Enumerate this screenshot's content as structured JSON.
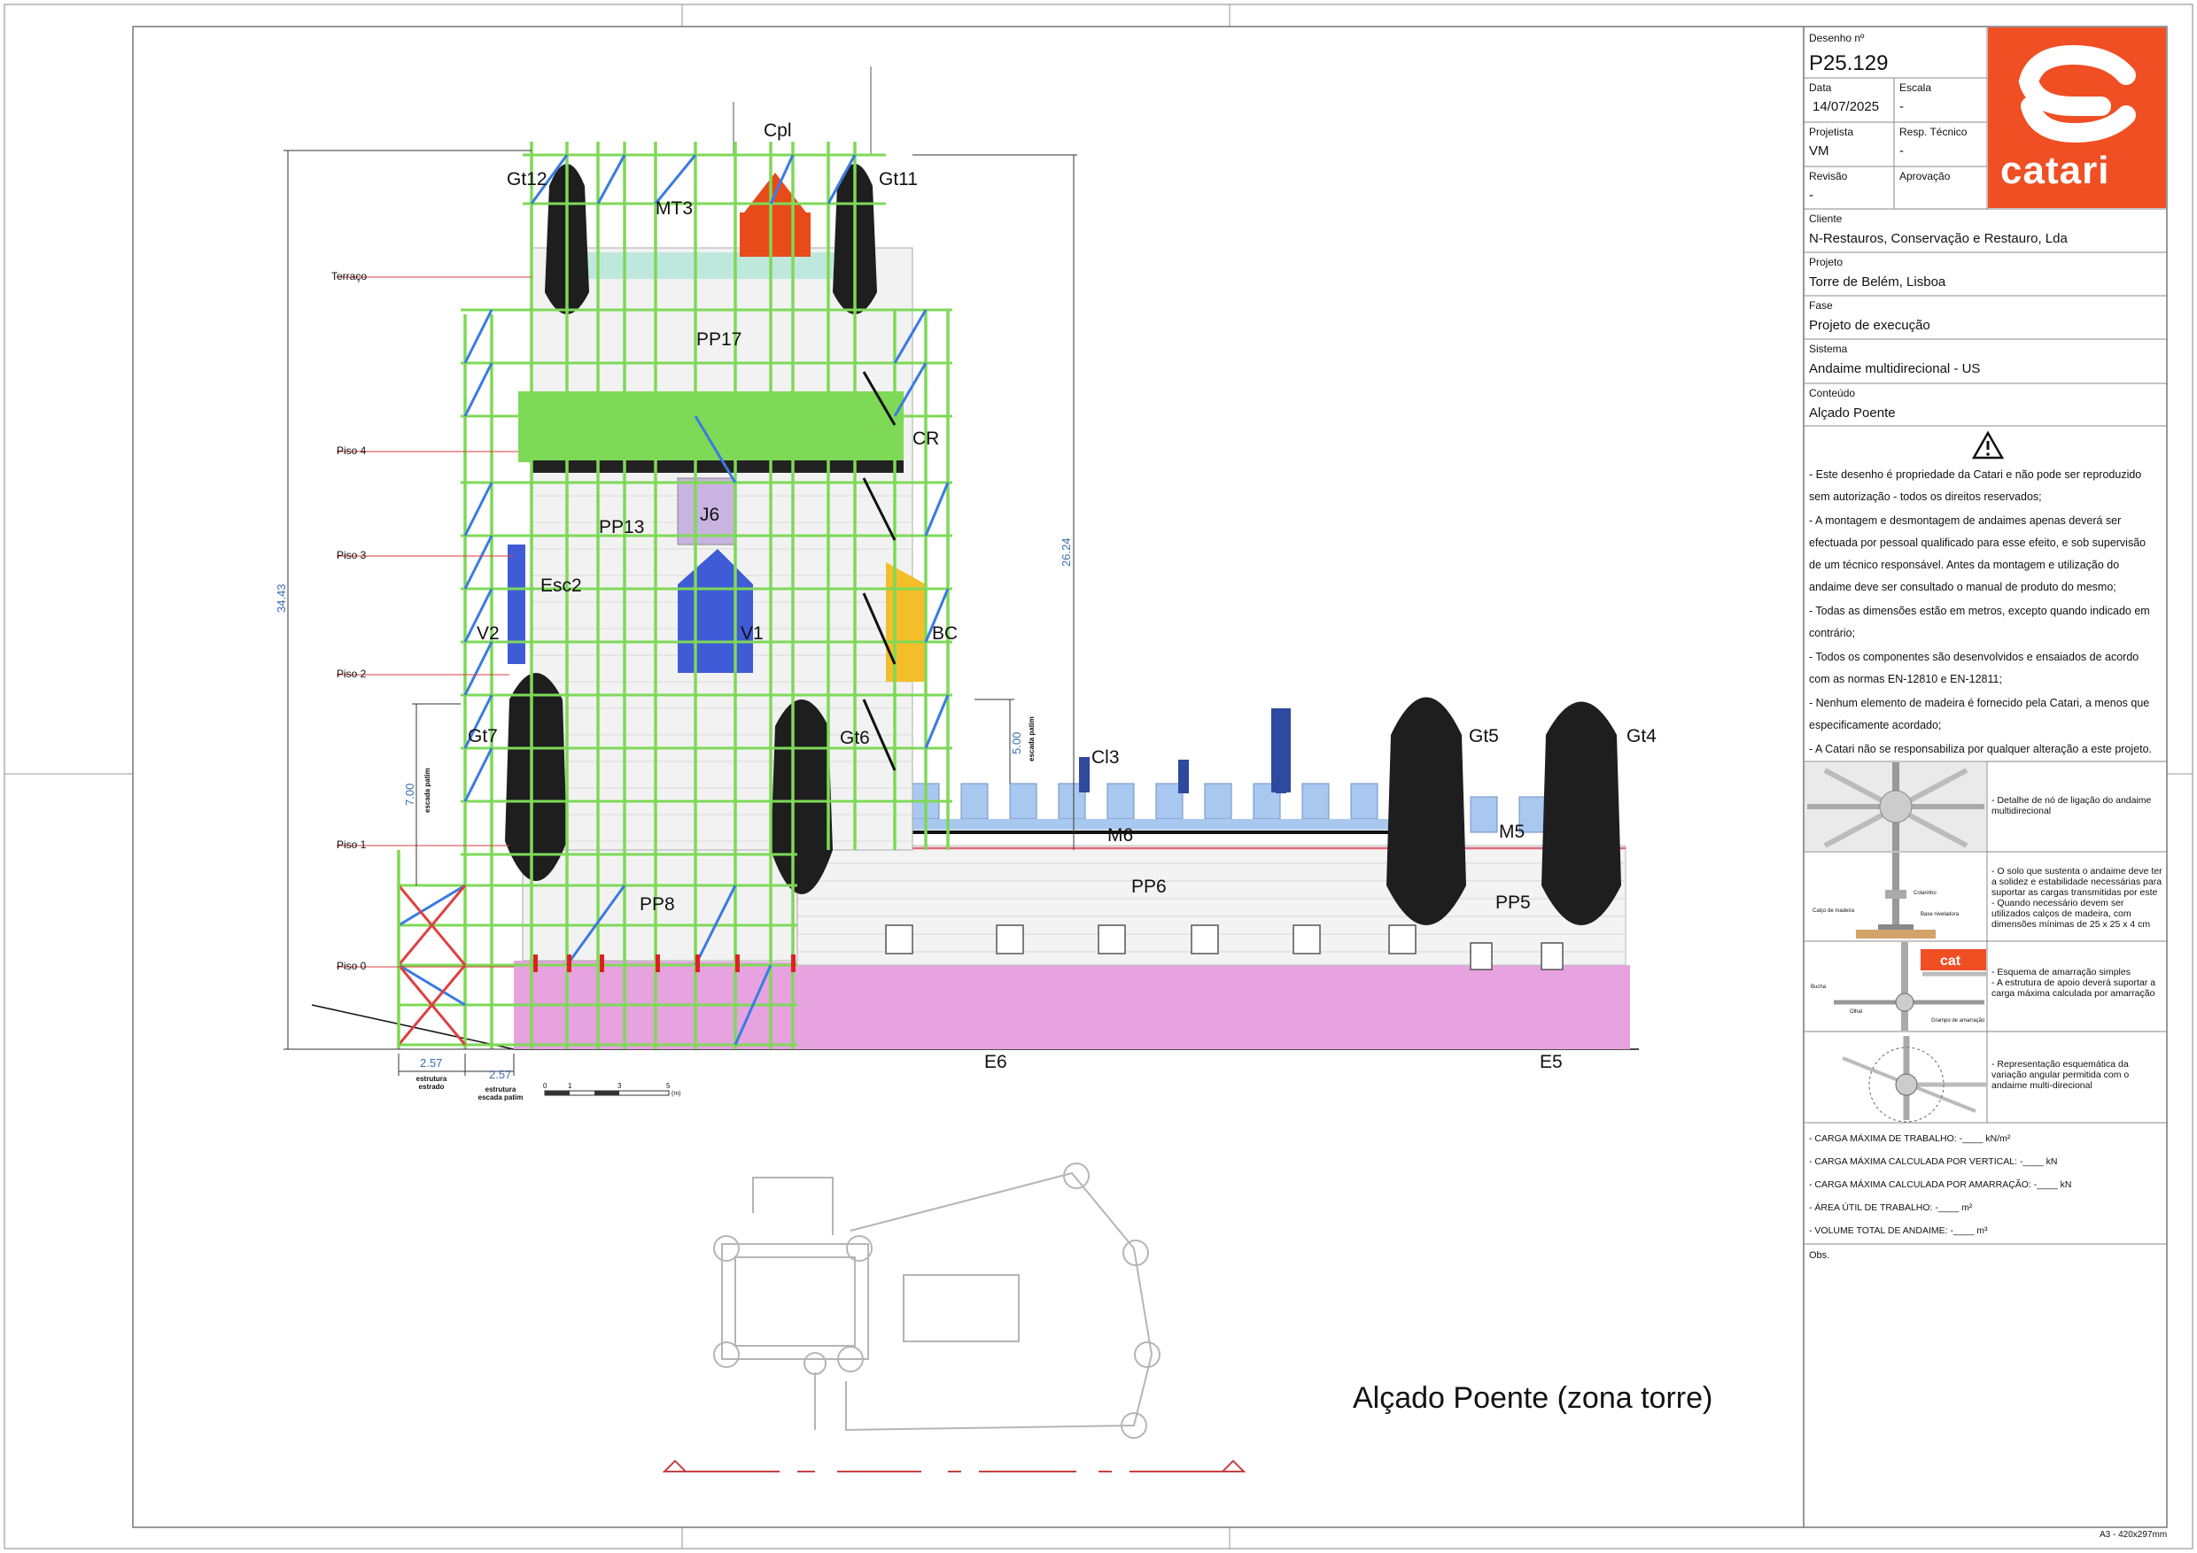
{
  "title_block": {
    "drawing_no_label": "Desenho nº",
    "drawing_no": "P25.129",
    "date_label": "Data",
    "date": "14/07/2025",
    "scale_label": "Escala",
    "scale": "-",
    "designer_label": "Projetista",
    "designer": "VM",
    "tech_label": "Resp. Técnico",
    "tech": "-",
    "revision_label": "Revisão",
    "revision": "-",
    "approval_label": "Aprovação",
    "client_label": "Cliente",
    "client": "N-Restauros, Conservação e Restauro, Lda",
    "project_label": "Projeto",
    "project": "Torre de Belém, Lisboa",
    "phase_label": "Fase",
    "phase": "Projeto de execução",
    "system_label": "Sistema",
    "system": "Andaime multidirecional - US",
    "content_label": "Conteúdo",
    "content": "Alçado Poente",
    "logo_text": "catari",
    "brand_color": "#f04e23"
  },
  "notes": [
    "- Este desenho é propriedade da Catari e não pode ser reproduzido sem autorização - todos os direitos reservados;",
    "- A montagem e desmontagem de andaimes apenas deverá ser efectuada por pessoal qualificado para esse efeito, e sob supervisão de um técnico responsável. Antes da montagem e utilização do andaime deve ser consultado o manual de produto do mesmo;",
    "- Todas as dimensões estão em metros, excepto quando indicado em contrário;",
    "- Todos os componentes são desenvolvidos e ensaiados de acordo com as normas EN-12810 e EN-12811;",
    "- Nenhum elemento de madeira é fornecido pela Catari, a menos que especificamente acordado;",
    "- A Catari não se responsabiliza por qualquer alteração a este projeto."
  ],
  "details": [
    "- Detalhe de nó de ligação do andaime multidirecional",
    "- O solo que sustenta o andaime deve ter a solidez e estabilidade necessárias para suportar as cargas transmitidas por este\n- Quando necessário devem ser utilizados calços de madeira, com dimensões mínimas de 25 x 25 x 4 cm",
    "- Esquema de amarração simples\n- A estrutura de apoio deverá suportar a carga máxima calculada por amarração",
    "- Representação esquemática da variação angular permitida com o andaime multi-direcional"
  ],
  "detail_labels": {
    "colarinho": "Colarinho",
    "calco": "Calço de madeira",
    "base": "Base niveladora",
    "bucha": "Bucha",
    "olhal": "Olhal",
    "grampo": "Grampo de amarração"
  },
  "loads": [
    "- CARGA MÁXIMA DE TRABALHO:  -____ kN/m²",
    "- CARGA MÁXIMA CALCULADA POR VERTICAL:  -____ kN",
    "- CARGA MÁXIMA CALCULADA POR AMARRAÇÃO:  -____ kN",
    "- ÁREA ÚTIL DE TRABALHO:  -____ m²",
    "- VOLUME TOTAL DE ANDAIME:  -____ m³"
  ],
  "obs_label": "Obs.",
  "paper_size": "A3 - 420x297mm",
  "drawing_title": "Alçado Poente (zona torre)",
  "levels": [
    "Terraço",
    "Piso  4",
    "Piso  3",
    "Piso  2",
    "Piso  1",
    "Piso  0"
  ],
  "tags": {
    "cpl": "Cpl",
    "gt12": "Gt12",
    "gt11": "Gt11",
    "mt3": "MT3",
    "pp17": "PP17",
    "cr": "CR",
    "j6": "J6",
    "pp13": "PP13",
    "esc2": "Esc2",
    "v2": "V2",
    "v1": "V1",
    "bc": "BC",
    "gt7": "Gt7",
    "gt6": "Gt6",
    "cl3": "Cl3",
    "m6": "M6",
    "gt5": "Gt5",
    "gt4": "Gt4",
    "m5": "M5",
    "pp8": "PP8",
    "pp6": "PP6",
    "pp5": "PP5",
    "e6": "E6",
    "e5": "E5"
  },
  "dimensions": {
    "total_height": "34.43",
    "tower_height": "26.24",
    "landing_height": "7.00",
    "landing_label": "escada patim",
    "upper_gap": "5.00",
    "upper_label": "escada patim",
    "width_a": "2.57",
    "width_a_label": "estrutura estrado",
    "width_b": "2.57",
    "width_b_label": "estrutura escada patim"
  },
  "scale_bar": [
    "0",
    "1",
    "3",
    "5",
    "(m)"
  ],
  "colors": {
    "scaffold": "#7ed957",
    "brace": "#3b7be0",
    "masonry": "#f2f2f2",
    "base": "#e6a3e0",
    "roof": "#e84a1a",
    "blue_elements": "#3f5bd6",
    "light_blue": "#a9c8f0",
    "yellow": "#f3be2a",
    "turret": "#1e1e1e"
  }
}
